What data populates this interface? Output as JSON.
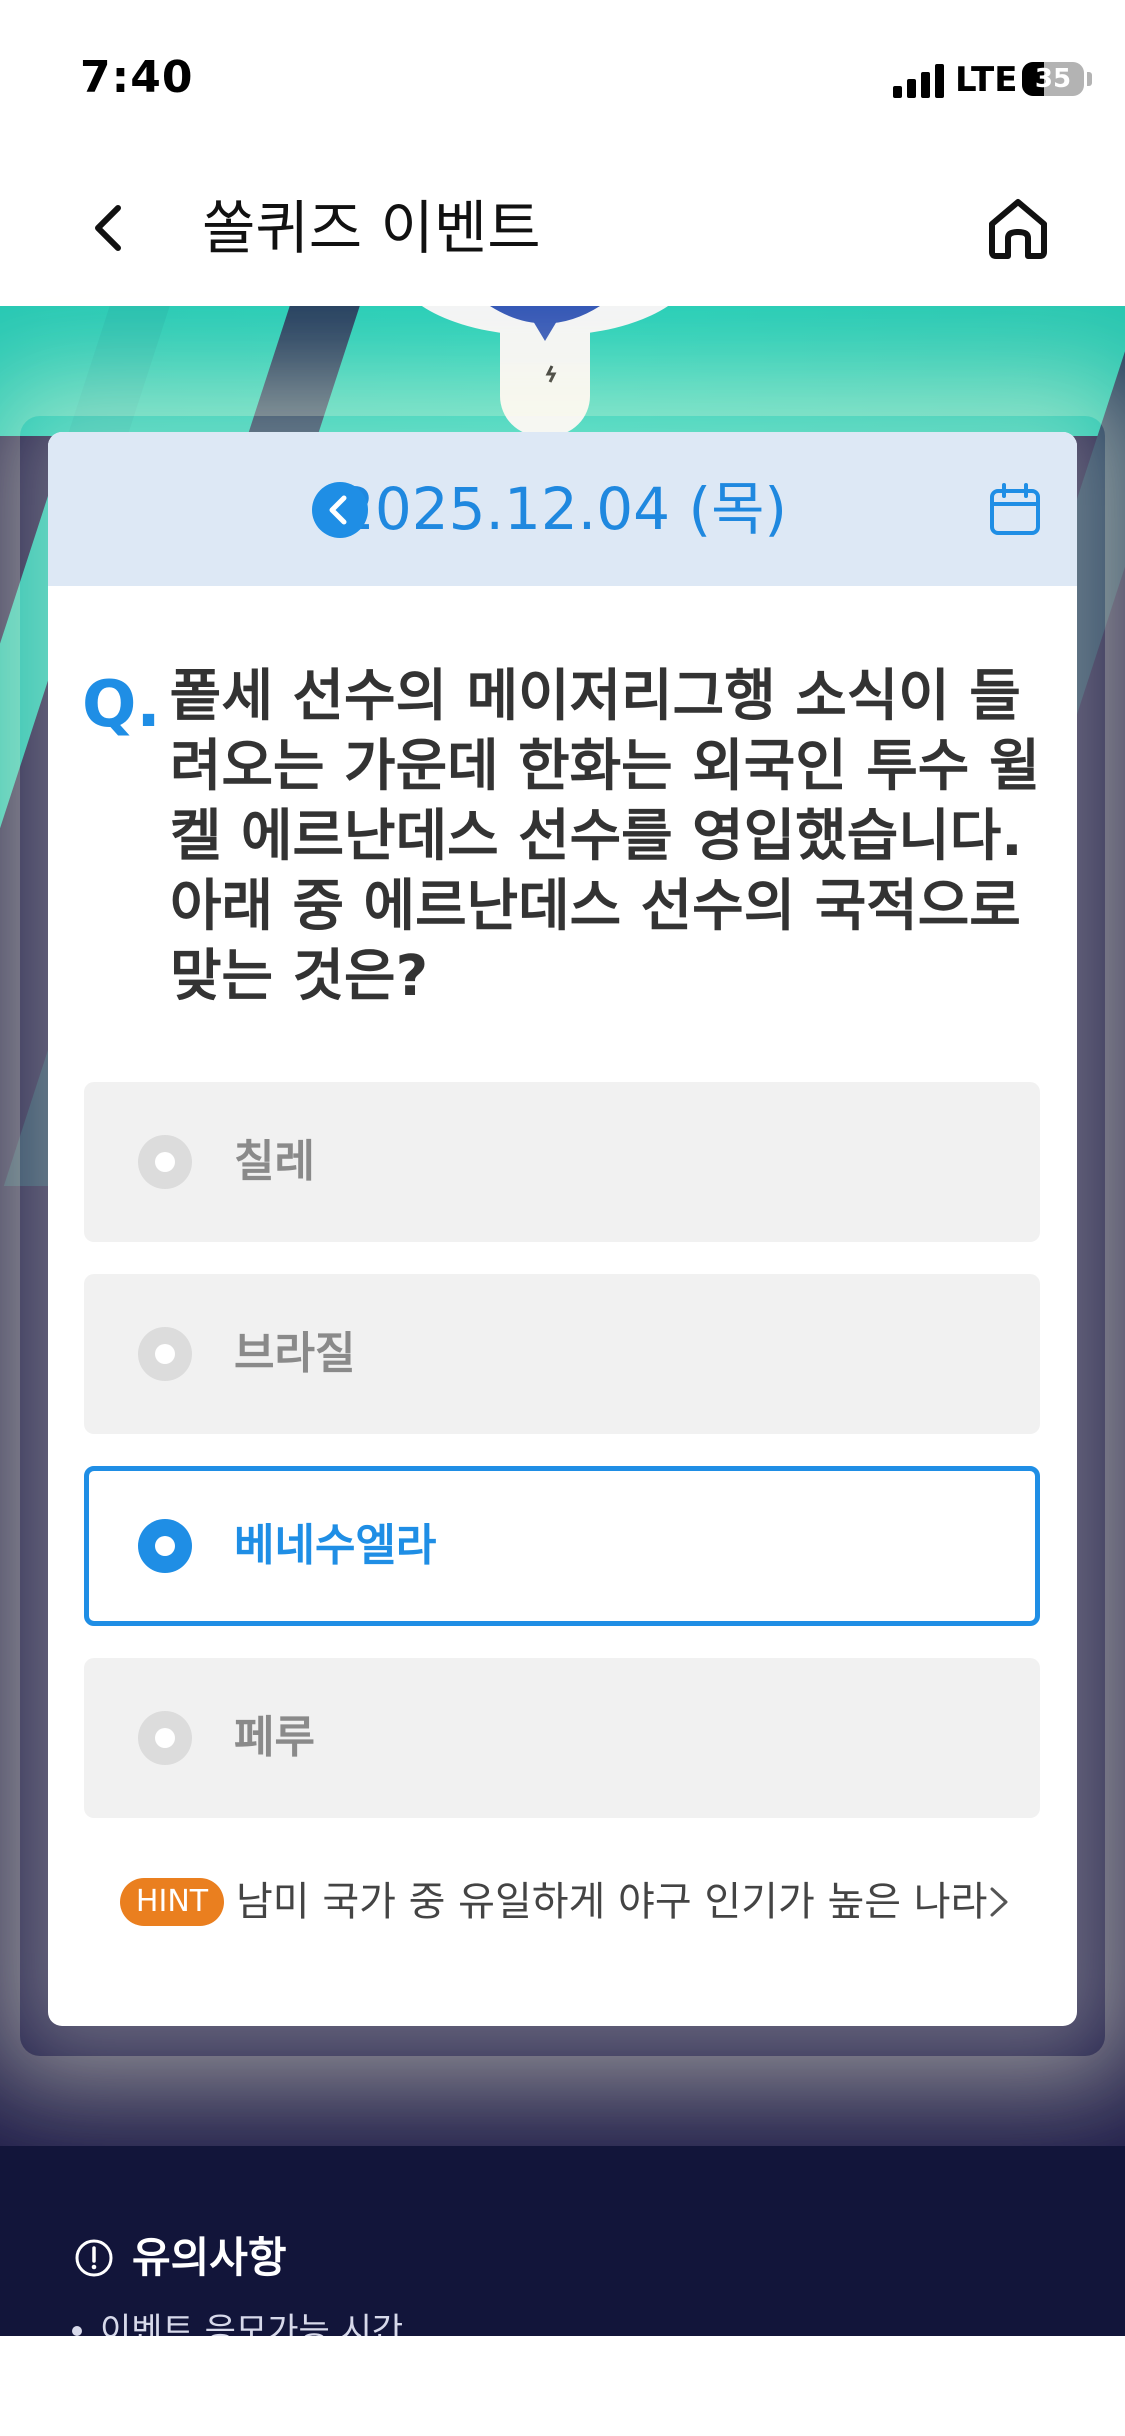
{
  "status_bar": {
    "time": "7:40",
    "network": "LTE",
    "battery": "35",
    "battery_level": 0.35
  },
  "header": {
    "title": "쏠퀴즈 이벤트",
    "back_icon": "chevron-left-icon",
    "home_icon": "home-icon"
  },
  "quiz": {
    "date": "2025.12.04 (목)",
    "q_prefix": "Q.",
    "question": "퐅세 선수의 메이저리그행 소식이 들려오는 가운데 한화는 외국인 투수 윌켈 에르난데스 선수를 영입했습니다. 아래 중 에르난데스 선수의 국적으로 맞는 것은?",
    "options": [
      {
        "label": "칠레",
        "selected": false
      },
      {
        "label": "브라질",
        "selected": false
      },
      {
        "label": "베네수엘라",
        "selected": true
      },
      {
        "label": "페루",
        "selected": false
      }
    ],
    "hint_badge": "HINT",
    "hint_text": "남미 국가 중 유일하게 야구 인기가 높은 나라"
  },
  "notice": {
    "title": "유의사항",
    "first_item": "이벤트 응모가능 시간"
  },
  "colors": {
    "accent": "#1f8ee5",
    "hint": "#ea7f1f",
    "date_bar": "#dde8f5",
    "background_dark": "#1c1a48"
  }
}
